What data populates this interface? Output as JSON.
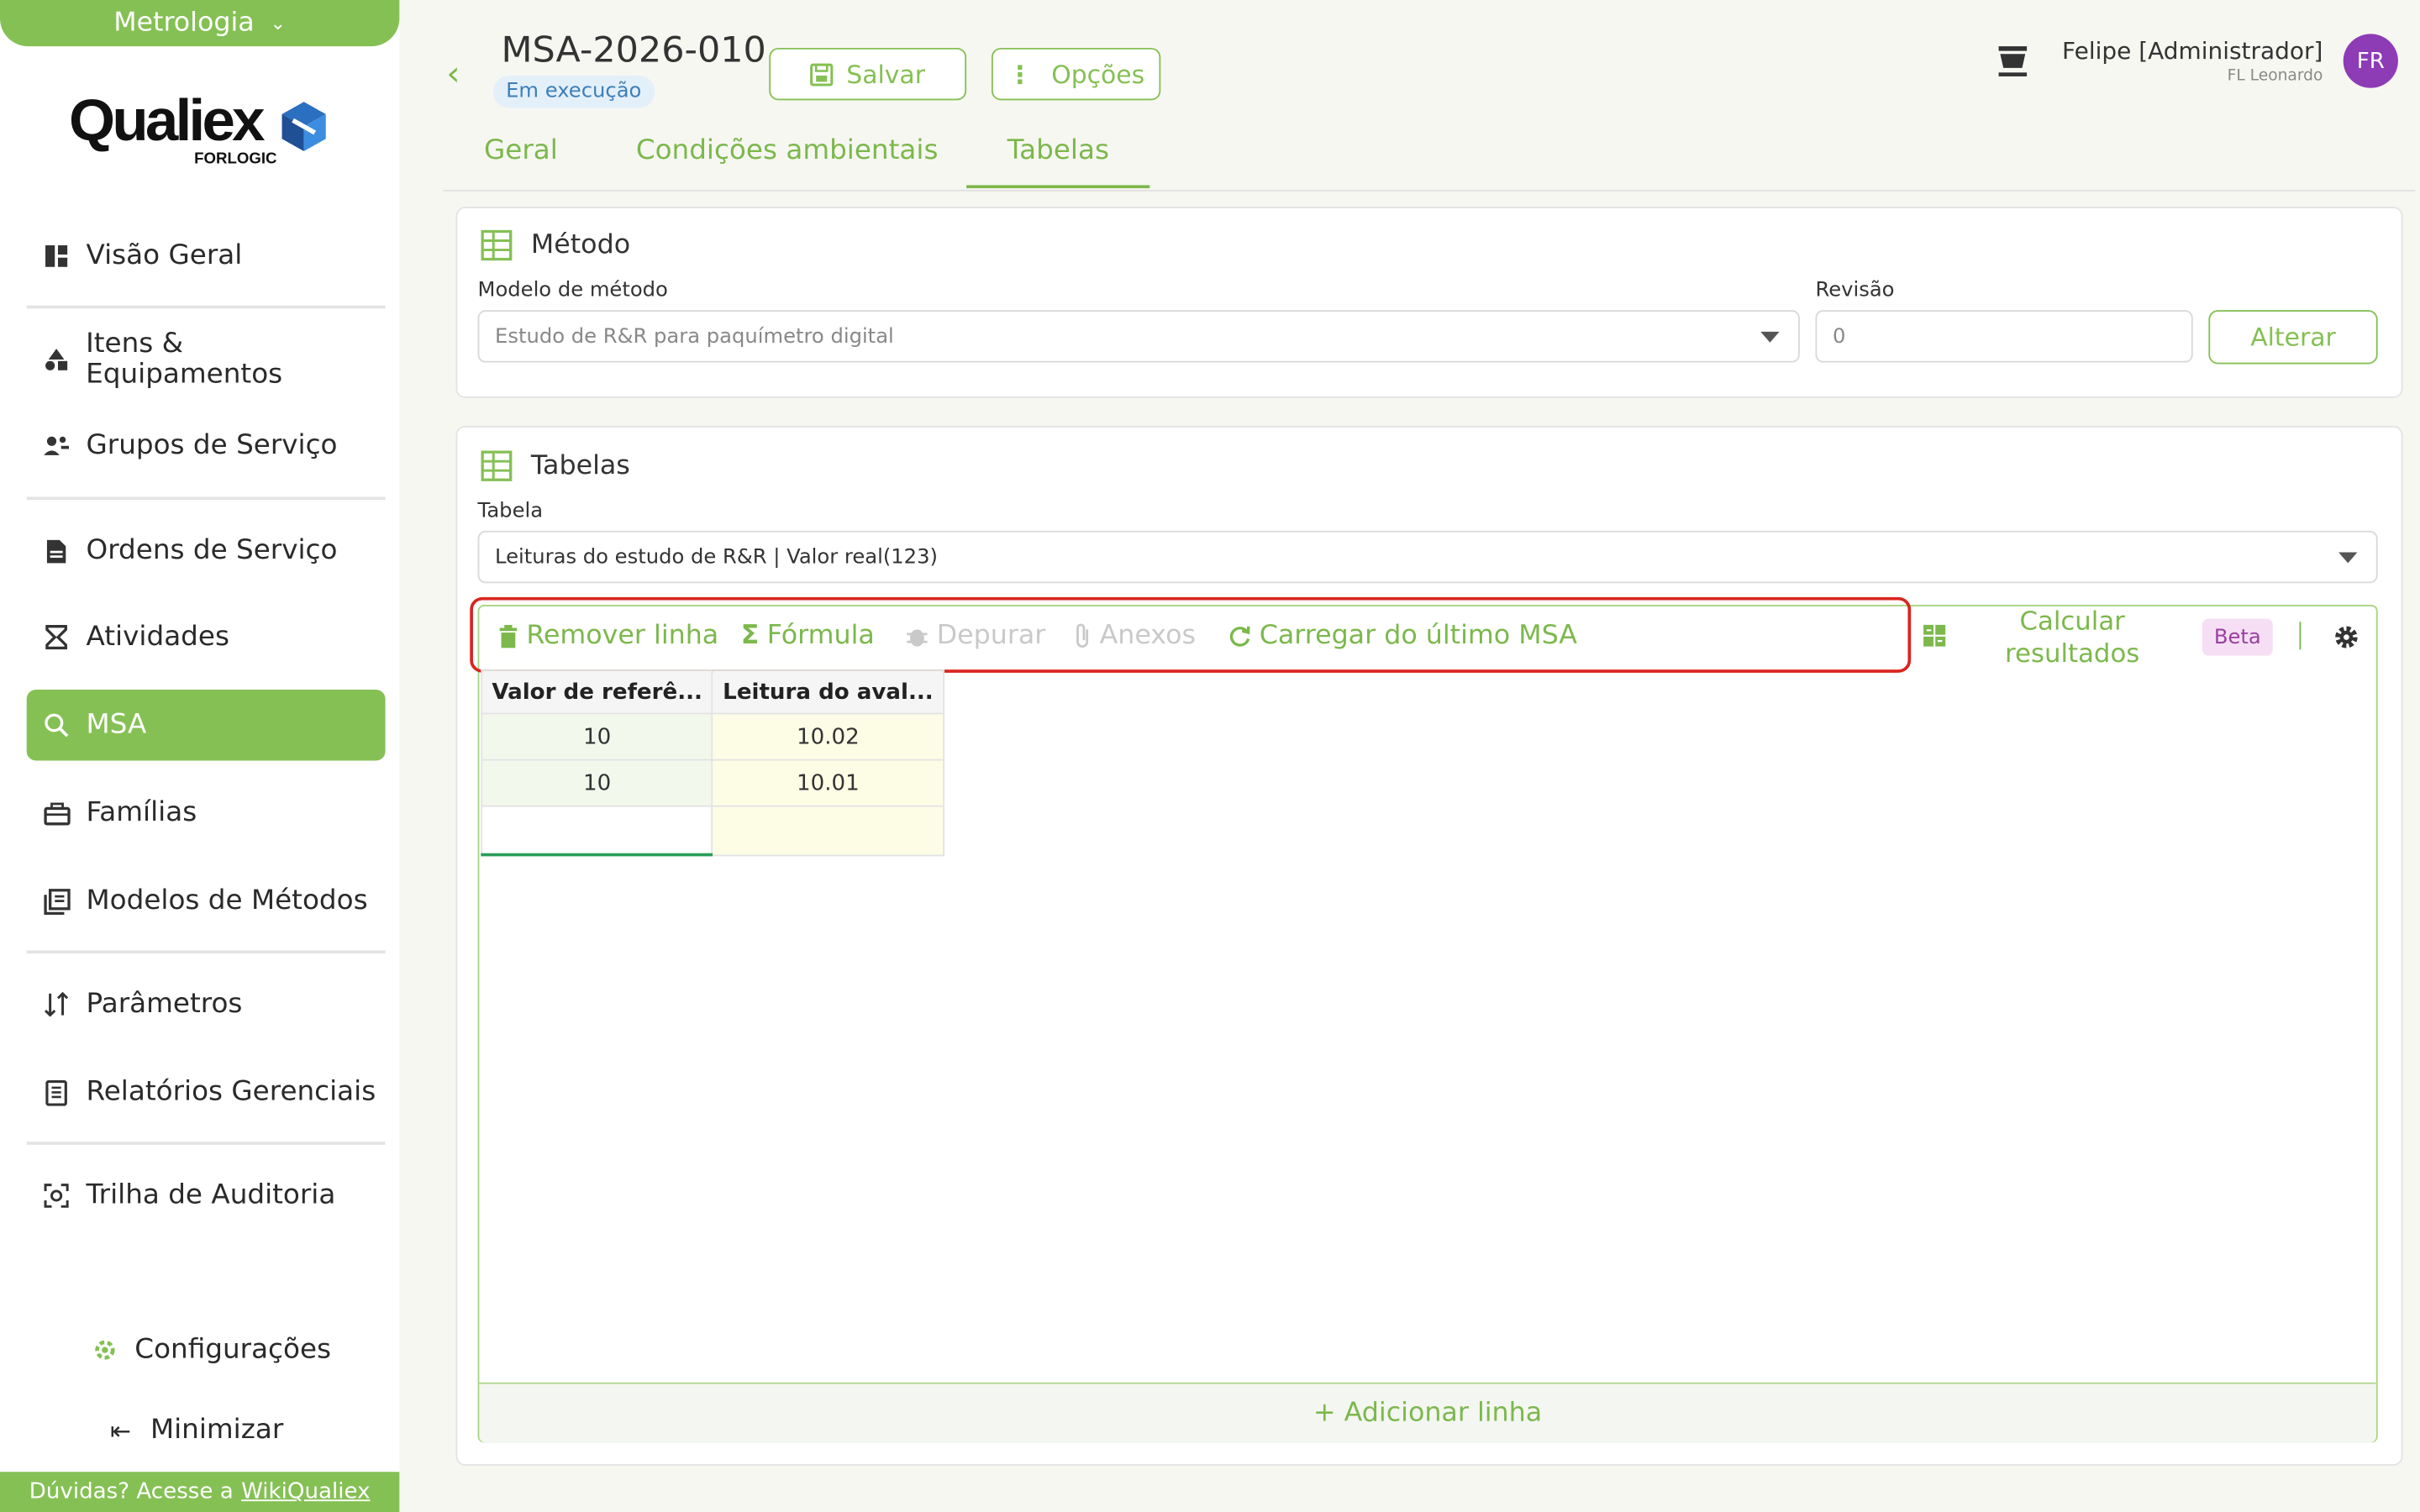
{
  "sidebar": {
    "module": "Metrologia",
    "logo_word": "Qualiex",
    "logo_sub": "FORLOGIC",
    "items": [
      {
        "label": "Visão Geral",
        "icon": "dashboard-icon"
      },
      {
        "label": "Itens & Equipamentos",
        "icon": "shapes-icon"
      },
      {
        "label": "Grupos de Serviço",
        "icon": "group-icon"
      },
      {
        "label": "Ordens de Serviço",
        "icon": "document-icon"
      },
      {
        "label": "Atividades",
        "icon": "hourglass-icon"
      },
      {
        "label": "MSA",
        "icon": "magnifier-icon",
        "active": true
      },
      {
        "label": "Famílias",
        "icon": "briefcase-icon"
      },
      {
        "label": "Modelos de Métodos",
        "icon": "library-icon"
      },
      {
        "label": "Parâmetros",
        "icon": "sort-icon"
      },
      {
        "label": "Relatórios Gerenciais",
        "icon": "report-icon"
      },
      {
        "label": "Trilha de Auditoria",
        "icon": "audit-icon"
      }
    ],
    "settings": "Configurações",
    "minimize": "Minimizar",
    "help_text": "Dúvidas? Acesse a",
    "help_link": "WikiQualiex"
  },
  "header": {
    "title": "MSA-2026-010",
    "status": "Em execução",
    "save": "Salvar",
    "options": "Opções",
    "user_name": "Felipe [Administrador]",
    "user_org": "FL Leonardo",
    "avatar": "FR"
  },
  "tabs": [
    {
      "label": "Geral"
    },
    {
      "label": "Condições ambientais"
    },
    {
      "label": "Tabelas",
      "active": true
    }
  ],
  "method_card": {
    "title": "Método",
    "model_label": "Modelo de método",
    "model_value": "Estudo de R&R para paquímetro digital",
    "revision_label": "Revisão",
    "revision_value": "0",
    "change_button": "Alterar"
  },
  "tables_card": {
    "title": "Tabelas",
    "table_label": "Tabela",
    "table_value": "Leituras do estudo de R&R | Valor real(123)",
    "toolbar": {
      "remove_row": "Remover linha",
      "formula": "Fórmula",
      "debug": "Depurar",
      "attachments": "Anexos",
      "load_last": "Carregar do último MSA",
      "calculate_line1": "Calcular",
      "calculate_line2": "resultados",
      "beta": "Beta"
    },
    "columns": [
      "Valor de referê...",
      "Leitura do aval..."
    ],
    "rows": [
      [
        "10",
        "10.02"
      ],
      [
        "10",
        "10.01"
      ],
      [
        "",
        ""
      ]
    ],
    "add_row": "+ Adicionar linha"
  },
  "colors": {
    "accent": "#85c054",
    "highlight": "#d9261f",
    "avatar": "#8e3bb6"
  }
}
